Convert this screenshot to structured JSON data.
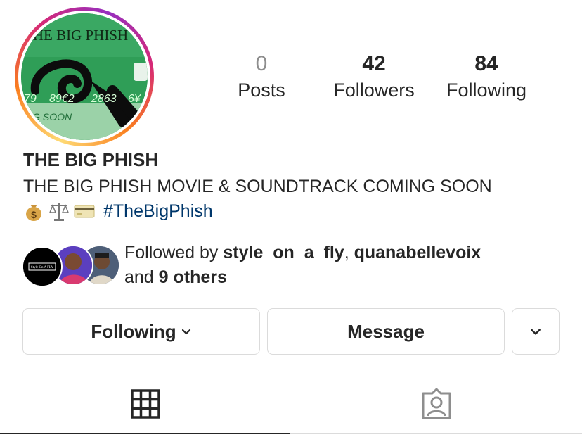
{
  "profile": {
    "display_name": "THE BIG PHISH",
    "bio_line1": "THE BIG PHISH MOVIE & SOUNDTRACK COMING SOON",
    "bio_emojis": [
      "money-bag",
      "balance-scale",
      "credit-card"
    ],
    "hashtag": "#TheBigPhish",
    "avatar_text": {
      "top": "THE BIG PHISH",
      "digits": [
        "79",
        "89€2",
        "2863",
        "6¥"
      ],
      "bottom": "NG SOON"
    }
  },
  "stats": {
    "posts": {
      "count": "0",
      "label": "Posts"
    },
    "followers": {
      "count": "42",
      "label": "Followers"
    },
    "following": {
      "count": "84",
      "label": "Following"
    }
  },
  "followed_by": {
    "prefix": "Followed by ",
    "user1": "style_on_a_fly",
    "separator": ", ",
    "user2": "quanabellevoix",
    "and_text": "and ",
    "others": "9 others",
    "avatar1_text": "Style On A FLY"
  },
  "buttons": {
    "following": "Following",
    "message": "Message"
  },
  "tabs": [
    {
      "name": "grid-icon",
      "active": true
    },
    {
      "name": "tagged-icon",
      "active": false
    }
  ],
  "colors": {
    "hashtag": "#00376b",
    "border": "#dbdbdb",
    "text": "#262626",
    "muted": "#8e8e8e"
  }
}
